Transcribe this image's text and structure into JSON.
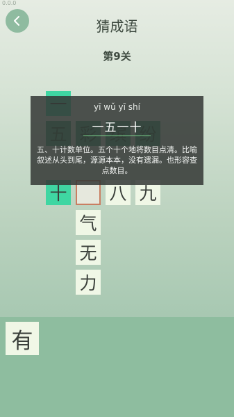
{
  "status": {
    "text": "0.0.0"
  },
  "header": {
    "back_icon": "chevron-left-icon",
    "title": "猜成语"
  },
  "level": {
    "label": "第9关"
  },
  "grid": {
    "c1": "一",
    "c2": "五",
    "c3": "彩",
    "c4": "缤",
    "c5": "纷",
    "c6": "十",
    "c7": "",
    "c8": "八",
    "c9": "九",
    "c10": "气",
    "c11": "无",
    "c12": "力"
  },
  "tooltip": {
    "pinyin": "yī wǔ yī shí",
    "idiom": "一五一十",
    "description": "五、十计数单位。五个十个地将数目点清。比喻叙述从头到尾，源源本本，没有遗漏。也形容查点数目。"
  },
  "answer_tray": {
    "tiles": [
      "有"
    ]
  },
  "colors": {
    "highlight": "#3fd6a2",
    "selected_border": "#c97e62",
    "tile_bg": "#f0f7e6",
    "tray_bg": "#8ebd9f",
    "back_button_bg": "#8fbba0"
  }
}
